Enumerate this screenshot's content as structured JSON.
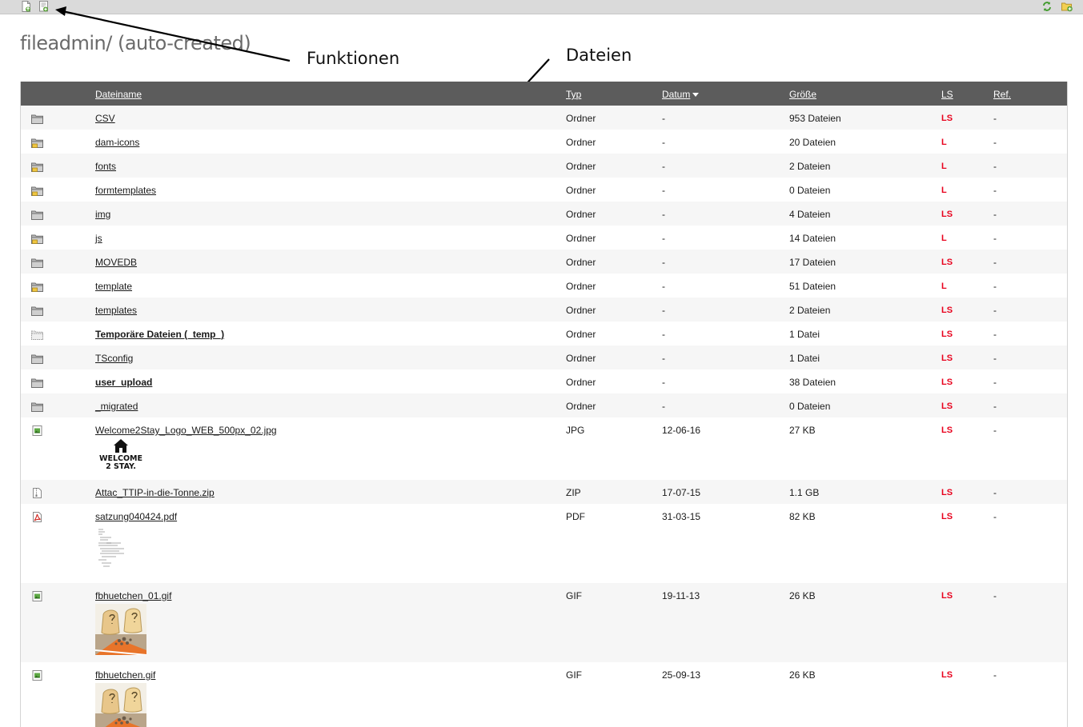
{
  "page": {
    "title": "fileadmin/ (auto-created)"
  },
  "toolbar": {
    "left_icons": [
      "upload-file-icon",
      "new-file-icon"
    ],
    "right_icons": [
      "refresh-icon",
      "new-folder-icon"
    ]
  },
  "annotations": {
    "functions_label": "Funktionen",
    "files_label": "Dateien"
  },
  "table": {
    "columns": {
      "name": "Dateiname",
      "type": "Typ",
      "date": "Datum",
      "size": "Größe",
      "ls": "LS",
      "ref": "Ref."
    },
    "sort_column": "Datum",
    "rows": [
      {
        "icon": "folder-icon",
        "name": "CSV",
        "type": "Ordner",
        "date": "-",
        "size": "953 Dateien",
        "ls": "LS",
        "ref": "-"
      },
      {
        "icon": "locked-folder-icon",
        "name": "dam-icons",
        "type": "Ordner",
        "date": "-",
        "size": "20 Dateien",
        "ls": "L",
        "ref": "-"
      },
      {
        "icon": "locked-folder-icon",
        "name": "fonts",
        "type": "Ordner",
        "date": "-",
        "size": "2 Dateien",
        "ls": "L",
        "ref": "-"
      },
      {
        "icon": "locked-folder-icon",
        "name": "formtemplates",
        "type": "Ordner",
        "date": "-",
        "size": "0 Dateien",
        "ls": "L",
        "ref": "-"
      },
      {
        "icon": "folder-icon",
        "name": "img",
        "type": "Ordner",
        "date": "-",
        "size": "4 Dateien",
        "ls": "LS",
        "ref": "-"
      },
      {
        "icon": "locked-folder-icon",
        "name": "js",
        "type": "Ordner",
        "date": "-",
        "size": "14 Dateien",
        "ls": "L",
        "ref": "-"
      },
      {
        "icon": "folder-icon",
        "name": "MOVEDB",
        "type": "Ordner",
        "date": "-",
        "size": "17 Dateien",
        "ls": "LS",
        "ref": "-"
      },
      {
        "icon": "locked-folder-icon",
        "name": "template",
        "type": "Ordner",
        "date": "-",
        "size": "51 Dateien",
        "ls": "L",
        "ref": "-"
      },
      {
        "icon": "folder-icon",
        "name": "templates",
        "type": "Ordner",
        "date": "-",
        "size": "2 Dateien",
        "ls": "LS",
        "ref": "-"
      },
      {
        "icon": "temp-folder-icon",
        "name": "Temporäre Dateien (_temp_)",
        "type": "Ordner",
        "date": "-",
        "size": "1 Datei",
        "ls": "LS",
        "ref": "-",
        "bold": true
      },
      {
        "icon": "folder-icon",
        "name": "TSconfig",
        "type": "Ordner",
        "date": "-",
        "size": "1 Datei",
        "ls": "LS",
        "ref": "-"
      },
      {
        "icon": "folder-icon",
        "name": "user_upload",
        "type": "Ordner",
        "date": "-",
        "size": "38 Dateien",
        "ls": "LS",
        "ref": "-",
        "bold": true
      },
      {
        "icon": "folder-icon",
        "name": "_migrated",
        "type": "Ordner",
        "date": "-",
        "size": "0 Dateien",
        "ls": "LS",
        "ref": "-"
      },
      {
        "icon": "image-file-icon",
        "name": "Welcome2Stay_Logo_WEB_500px_02.jpg",
        "type": "JPG",
        "date": "12-06-16",
        "size": "27 KB",
        "ls": "LS",
        "ref": "-",
        "thumb": "logo",
        "logo_text": [
          "WELCOME",
          "2 STAY."
        ]
      },
      {
        "icon": "zip-file-icon",
        "name": "Attac_TTIP-in-die-Tonne.zip",
        "type": "ZIP",
        "date": "17-07-15",
        "size": "1.1 GB",
        "ls": "LS",
        "ref": "-"
      },
      {
        "icon": "pdf-file-icon",
        "name": "satzung040424.pdf",
        "type": "PDF",
        "date": "31-03-15",
        "size": "82 KB",
        "ls": "LS",
        "ref": "-",
        "thumb": "doc"
      },
      {
        "icon": "image-file-icon",
        "name": "fbhuetchen_01.gif",
        "type": "GIF",
        "date": "19-11-13",
        "size": "26 KB",
        "ls": "LS",
        "ref": "-",
        "thumb": "photo"
      },
      {
        "icon": "image-file-icon",
        "name": "fbhuetchen.gif",
        "type": "GIF",
        "date": "25-09-13",
        "size": "26 KB",
        "ls": "LS",
        "ref": "-",
        "thumb": "photo"
      }
    ]
  }
}
